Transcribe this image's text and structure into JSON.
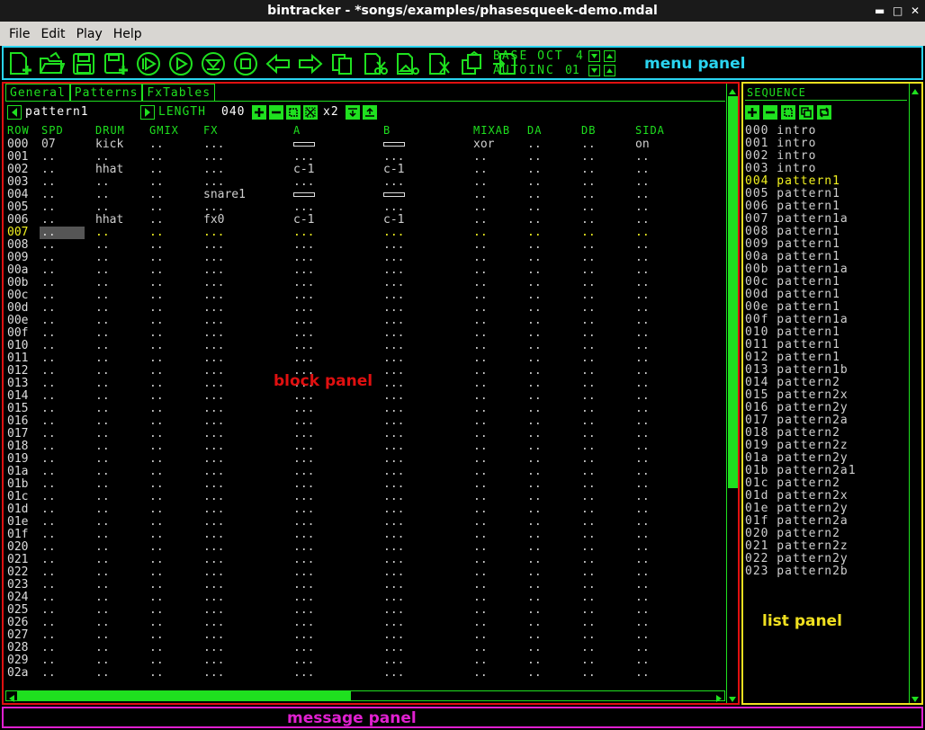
{
  "window": {
    "title": "bintracker - *songs/examples/phasesqueek-demo.mdal"
  },
  "menubar": {
    "items": [
      "File",
      "Edit",
      "Play",
      "Help"
    ]
  },
  "toolbar": {
    "base_oct_label": "BASE OCT",
    "base_oct_value": "4",
    "autoinc_label": "AUTOINC",
    "autoinc_value": "01",
    "icons": [
      "new-file-icon",
      "open-folder-icon",
      "save-icon",
      "save-as-icon",
      "play-song-icon",
      "play-pattern-icon",
      "stop-playback-icon",
      "stop-icon",
      "undo-icon",
      "redo-icon",
      "copy-icon",
      "cut-icon",
      "paste-icon",
      "clear-icon",
      "porous-paste-icon",
      "insert-icon"
    ]
  },
  "annotations": {
    "menu_panel": "menu panel",
    "block_panel": "block panel",
    "list_panel": "list panel",
    "message_panel": "message panel"
  },
  "colors": {
    "accent": "#1fe01f",
    "menu_panel": "#2ad4f0",
    "block_panel": "#e01010",
    "list_panel": "#f0e020",
    "message_panel": "#e020d0"
  },
  "block": {
    "tabs": [
      "General",
      "Patterns",
      "FxTables"
    ],
    "pattern_name": "pattern1",
    "length_label": "LENGTH",
    "length_value": "040",
    "zoom_label": "x2",
    "columns": [
      "ROW",
      "SPD",
      "DRUM",
      "GMIX",
      "FX",
      "A",
      "B",
      "MIXAB",
      "DA",
      "DB",
      "SIDA"
    ],
    "rows": [
      [
        "000",
        "07",
        "kick",
        "..",
        "...",
        "BAR",
        "BAR",
        "xor",
        "..",
        "..",
        "on"
      ],
      [
        "001",
        "..",
        "..",
        "..",
        "...",
        "...",
        "...",
        "..",
        "..",
        "..",
        ".."
      ],
      [
        "002",
        "..",
        "hhat",
        "..",
        "...",
        "c-1",
        "c-1",
        "..",
        "..",
        "..",
        ".."
      ],
      [
        "003",
        "..",
        "..",
        "..",
        "...",
        "...",
        "...",
        "..",
        "..",
        "..",
        ".."
      ],
      [
        "004",
        "..",
        "..",
        "..",
        "snare1",
        "BAR",
        "BAR",
        "..",
        "..",
        "..",
        ".."
      ],
      [
        "005",
        "..",
        "..",
        "..",
        "...",
        "...",
        "...",
        "..",
        "..",
        "..",
        ".."
      ],
      [
        "006",
        "..",
        "hhat",
        "..",
        "fx0",
        "c-1",
        "c-1",
        "..",
        "..",
        "..",
        ".."
      ],
      [
        "007",
        "..",
        "..",
        "..",
        "...",
        "...",
        "...",
        "..",
        "..",
        "..",
        ".."
      ],
      [
        "008",
        "..",
        "..",
        "..",
        "...",
        "...",
        "...",
        "..",
        "..",
        "..",
        ".."
      ],
      [
        "009",
        "..",
        "..",
        "..",
        "...",
        "...",
        "...",
        "..",
        "..",
        "..",
        ".."
      ],
      [
        "00a",
        "..",
        "..",
        "..",
        "...",
        "...",
        "...",
        "..",
        "..",
        "..",
        ".."
      ],
      [
        "00b",
        "..",
        "..",
        "..",
        "...",
        "...",
        "...",
        "..",
        "..",
        "..",
        ".."
      ],
      [
        "00c",
        "..",
        "..",
        "..",
        "...",
        "...",
        "...",
        "..",
        "..",
        "..",
        ".."
      ],
      [
        "00d",
        "..",
        "..",
        "..",
        "...",
        "...",
        "...",
        "..",
        "..",
        "..",
        ".."
      ],
      [
        "00e",
        "..",
        "..",
        "..",
        "...",
        "...",
        "...",
        "..",
        "..",
        "..",
        ".."
      ],
      [
        "00f",
        "..",
        "..",
        "..",
        "...",
        "...",
        "...",
        "..",
        "..",
        "..",
        ".."
      ],
      [
        "010",
        "..",
        "..",
        "..",
        "...",
        "...",
        "...",
        "..",
        "..",
        "..",
        ".."
      ],
      [
        "011",
        "..",
        "..",
        "..",
        "...",
        "...",
        "...",
        "..",
        "..",
        "..",
        ".."
      ],
      [
        "012",
        "..",
        "..",
        "..",
        "...",
        "...",
        "...",
        "..",
        "..",
        "..",
        ".."
      ],
      [
        "013",
        "..",
        "..",
        "..",
        "...",
        "...",
        "...",
        "..",
        "..",
        "..",
        ".."
      ],
      [
        "014",
        "..",
        "..",
        "..",
        "...",
        "...",
        "...",
        "..",
        "..",
        "..",
        ".."
      ],
      [
        "015",
        "..",
        "..",
        "..",
        "...",
        "...",
        "...",
        "..",
        "..",
        "..",
        ".."
      ],
      [
        "016",
        "..",
        "..",
        "..",
        "...",
        "...",
        "...",
        "..",
        "..",
        "..",
        ".."
      ],
      [
        "017",
        "..",
        "..",
        "..",
        "...",
        "...",
        "...",
        "..",
        "..",
        "..",
        ".."
      ],
      [
        "018",
        "..",
        "..",
        "..",
        "...",
        "...",
        "...",
        "..",
        "..",
        "..",
        ".."
      ],
      [
        "019",
        "..",
        "..",
        "..",
        "...",
        "...",
        "...",
        "..",
        "..",
        "..",
        ".."
      ],
      [
        "01a",
        "..",
        "..",
        "..",
        "...",
        "...",
        "...",
        "..",
        "..",
        "..",
        ".."
      ],
      [
        "01b",
        "..",
        "..",
        "..",
        "...",
        "...",
        "...",
        "..",
        "..",
        "..",
        ".."
      ],
      [
        "01c",
        "..",
        "..",
        "..",
        "...",
        "...",
        "...",
        "..",
        "..",
        "..",
        ".."
      ],
      [
        "01d",
        "..",
        "..",
        "..",
        "...",
        "...",
        "...",
        "..",
        "..",
        "..",
        ".."
      ],
      [
        "01e",
        "..",
        "..",
        "..",
        "...",
        "...",
        "...",
        "..",
        "..",
        "..",
        ".."
      ],
      [
        "01f",
        "..",
        "..",
        "..",
        "...",
        "...",
        "...",
        "..",
        "..",
        "..",
        ".."
      ],
      [
        "020",
        "..",
        "..",
        "..",
        "...",
        "...",
        "...",
        "..",
        "..",
        "..",
        ".."
      ],
      [
        "021",
        "..",
        "..",
        "..",
        "...",
        "...",
        "...",
        "..",
        "..",
        "..",
        ".."
      ],
      [
        "022",
        "..",
        "..",
        "..",
        "...",
        "...",
        "...",
        "..",
        "..",
        "..",
        ".."
      ],
      [
        "023",
        "..",
        "..",
        "..",
        "...",
        "...",
        "...",
        "..",
        "..",
        "..",
        ".."
      ],
      [
        "024",
        "..",
        "..",
        "..",
        "...",
        "...",
        "...",
        "..",
        "..",
        "..",
        ".."
      ],
      [
        "025",
        "..",
        "..",
        "..",
        "...",
        "...",
        "...",
        "..",
        "..",
        "..",
        ".."
      ],
      [
        "026",
        "..",
        "..",
        "..",
        "...",
        "...",
        "...",
        "..",
        "..",
        "..",
        ".."
      ],
      [
        "027",
        "..",
        "..",
        "..",
        "...",
        "...",
        "...",
        "..",
        "..",
        "..",
        ".."
      ],
      [
        "028",
        "..",
        "..",
        "..",
        "...",
        "...",
        "...",
        "..",
        "..",
        "..",
        ".."
      ],
      [
        "029",
        "..",
        "..",
        "..",
        "...",
        "...",
        "...",
        "..",
        "..",
        "..",
        ".."
      ],
      [
        "02a",
        "..",
        "..",
        "..",
        "...",
        "...",
        "...",
        "..",
        "..",
        "..",
        ".."
      ]
    ],
    "current_row": "007",
    "scroll": {
      "vertical_thumb_fraction": 0.66,
      "horizontal_thumb_fraction": 0.48
    }
  },
  "sequence": {
    "title": "SEQUENCE",
    "selected_index": "004",
    "items": [
      [
        "000",
        "intro"
      ],
      [
        "001",
        "intro"
      ],
      [
        "002",
        "intro"
      ],
      [
        "003",
        "intro"
      ],
      [
        "004",
        "pattern1"
      ],
      [
        "005",
        "pattern1"
      ],
      [
        "006",
        "pattern1"
      ],
      [
        "007",
        "pattern1a"
      ],
      [
        "008",
        "pattern1"
      ],
      [
        "009",
        "pattern1"
      ],
      [
        "00a",
        "pattern1"
      ],
      [
        "00b",
        "pattern1a"
      ],
      [
        "00c",
        "pattern1"
      ],
      [
        "00d",
        "pattern1"
      ],
      [
        "00e",
        "pattern1"
      ],
      [
        "00f",
        "pattern1a"
      ],
      [
        "010",
        "pattern1"
      ],
      [
        "011",
        "pattern1"
      ],
      [
        "012",
        "pattern1"
      ],
      [
        "013",
        "pattern1b"
      ],
      [
        "014",
        "pattern2"
      ],
      [
        "015",
        "pattern2x"
      ],
      [
        "016",
        "pattern2y"
      ],
      [
        "017",
        "pattern2a"
      ],
      [
        "018",
        "pattern2"
      ],
      [
        "019",
        "pattern2z"
      ],
      [
        "01a",
        "pattern2y"
      ],
      [
        "01b",
        "pattern2a1"
      ],
      [
        "01c",
        "pattern2"
      ],
      [
        "01d",
        "pattern2x"
      ],
      [
        "01e",
        "pattern2y"
      ],
      [
        "01f",
        "pattern2a"
      ],
      [
        "020",
        "pattern2"
      ],
      [
        "021",
        "pattern2z"
      ],
      [
        "022",
        "pattern2y"
      ],
      [
        "023",
        "pattern2b"
      ]
    ]
  }
}
